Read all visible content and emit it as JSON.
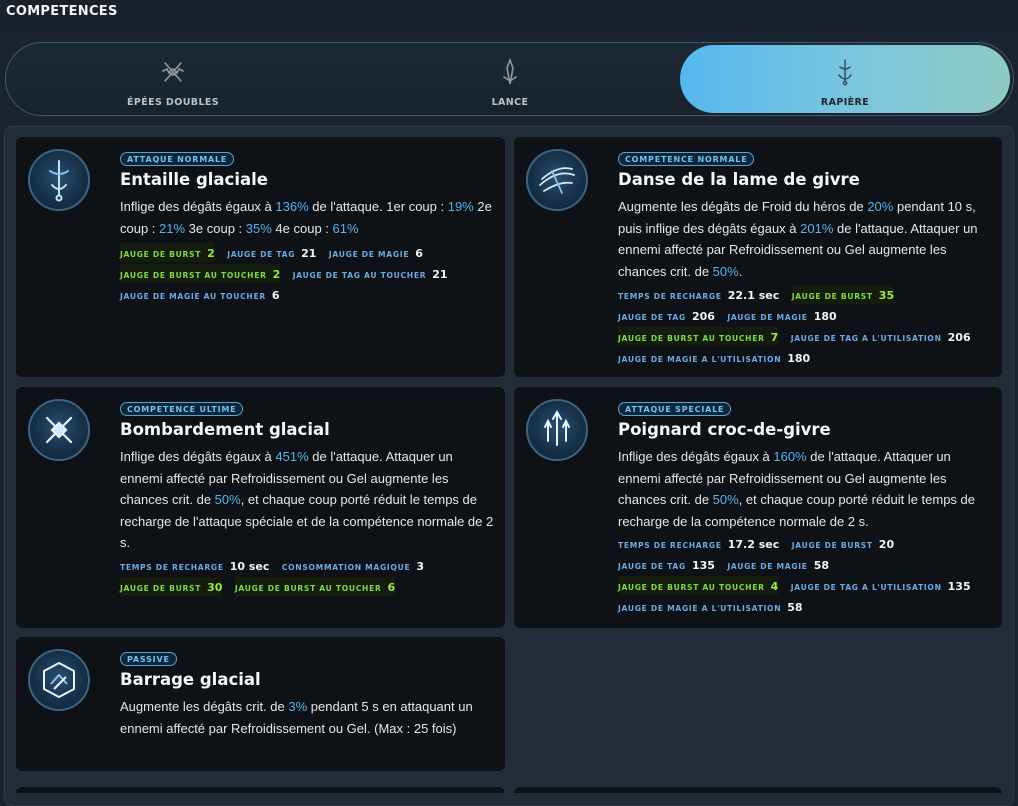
{
  "header": {
    "title": "COMPETENCES"
  },
  "tabs": [
    {
      "label": "ÉPÉES DOUBLES",
      "icon": "dual-swords-icon",
      "active": false
    },
    {
      "label": "LANCE",
      "icon": "lance-icon",
      "active": false
    },
    {
      "label": "RAPIÈRE",
      "icon": "rapier-icon",
      "active": true
    }
  ],
  "cards": [
    {
      "badge": "ATTAQUE NORMALE",
      "title": "Entaille glaciale",
      "icon": "ice-slash-icon",
      "desc_parts": [
        "Inflige des dégâts égaux à ",
        "136%",
        " de l'attaque. 1er coup : ",
        "19%",
        " 2e coup : ",
        "21%",
        " 3e coup : ",
        "35%",
        " 4e coup : ",
        "61%"
      ],
      "stats": [
        [
          {
            "label": "JAUGE DE BURST",
            "value": "2",
            "green": true
          },
          {
            "label": "JAUGE DE TAG",
            "value": "21"
          },
          {
            "label": "JAUGE DE MAGIE",
            "value": "6"
          }
        ],
        [
          {
            "label": "JAUGE DE BURST AU TOUCHER",
            "value": "2",
            "green": true
          },
          {
            "label": "JAUGE DE TAG AU TOUCHER",
            "value": "21"
          }
        ],
        [
          {
            "label": "JAUGE DE MAGIE AU TOUCHER",
            "value": "6"
          }
        ]
      ]
    },
    {
      "badge": "COMPETENCE NORMALE",
      "title": "Danse de la lame de givre",
      "icon": "frost-blade-dance-icon",
      "desc_parts": [
        "Augmente les dégâts de Froid du héros de ",
        "20%",
        " pendant 10 s, puis inflige des dégâts égaux à ",
        "201%",
        " de l'attaque. Attaquer un ennemi affecté par Refroidissement ou Gel augmente les chances crit. de ",
        "50%",
        "."
      ],
      "stats": [
        [
          {
            "label": "TEMPS DE RECHARGE",
            "value": "22.1 sec"
          },
          {
            "label": "JAUGE DE BURST",
            "value": "35",
            "green": true
          }
        ],
        [
          {
            "label": "JAUGE DE TAG",
            "value": "206"
          },
          {
            "label": "JAUGE DE MAGIE",
            "value": "180"
          }
        ],
        [
          {
            "label": "JAUGE DE BURST AU TOUCHER",
            "value": "7",
            "green": true
          },
          {
            "label": "JAUGE DE TAG A L'UTILISATION",
            "value": "206"
          }
        ],
        [
          {
            "label": "JAUGE DE MAGIE A L'UTILISATION",
            "value": "180"
          }
        ]
      ]
    },
    {
      "badge": "COMPETENCE ULTIME",
      "title": "Bombardement glacial",
      "icon": "ice-burst-icon",
      "desc_parts": [
        "Inflige des dégâts égaux à ",
        "451%",
        " de l'attaque. Attaquer un ennemi affecté par Refroidissement ou Gel augmente les chances crit. de ",
        "50%",
        ", et chaque coup porté réduit le temps de recharge de l'attaque spéciale et de la compétence normale de 2 s."
      ],
      "stats": [
        [
          {
            "label": "TEMPS DE RECHARGE",
            "value": "10 sec"
          },
          {
            "label": "CONSOMMATION MAGIQUE",
            "value": "3"
          }
        ],
        [
          {
            "label": "JAUGE DE BURST",
            "value": "30",
            "green": true
          },
          {
            "label": "JAUGE DE BURST AU TOUCHER",
            "value": "6",
            "green": true
          }
        ]
      ]
    },
    {
      "badge": "ATTAQUE SPECIALE",
      "title": "Poignard croc-de-givre",
      "icon": "frost-fang-dagger-icon",
      "desc_parts": [
        "Inflige des dégâts égaux à ",
        "160%",
        " de l'attaque. Attaquer un ennemi affecté par Refroidissement ou Gel augmente les chances crit. de ",
        "50%",
        ", et chaque coup porté réduit le temps de recharge de la compétence normale de 2 s."
      ],
      "stats": [
        [
          {
            "label": "TEMPS DE RECHARGE",
            "value": "17.2 sec"
          },
          {
            "label": "JAUGE DE BURST",
            "value": "20"
          }
        ],
        [
          {
            "label": "JAUGE DE TAG",
            "value": "135"
          },
          {
            "label": "JAUGE DE MAGIE",
            "value": "58"
          }
        ],
        [
          {
            "label": "JAUGE DE BURST AU TOUCHER",
            "value": "4",
            "green": true
          },
          {
            "label": "JAUGE DE TAG A L'UTILISATION",
            "value": "135"
          }
        ],
        [
          {
            "label": "JAUGE DE MAGIE A L'UTILISATION",
            "value": "58"
          }
        ]
      ]
    },
    {
      "badge": "PASSIVE",
      "title": "Barrage glacial",
      "icon": "ice-shield-icon",
      "desc_parts": [
        "Augmente les dégâts crit. de ",
        "3%",
        " pendant 5 s en attaquant un ennemi affecté par Refroidissement ou Gel. (Max : 25 fois)"
      ],
      "stats": []
    }
  ],
  "colors": {
    "accent": "#56b3ef",
    "green": "#9be84a",
    "card_bg": "#0e1116",
    "active_tab": "#5cbbe8"
  }
}
